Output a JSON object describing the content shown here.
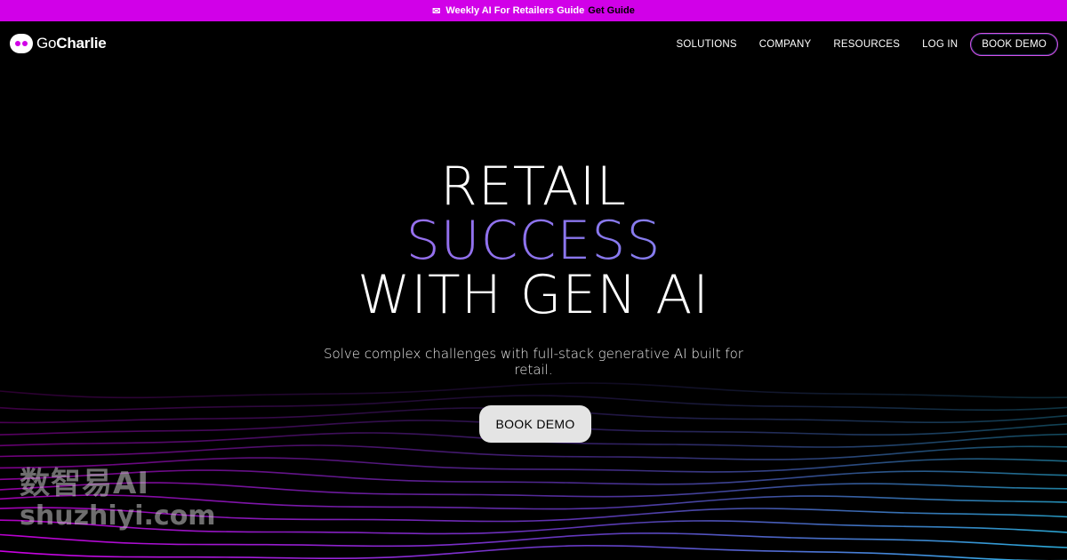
{
  "promo": {
    "icon": "envelope-icon",
    "text": "Weekly AI For Retailers Guide",
    "link": "Get Guide",
    "bg_color": "#d100e8"
  },
  "nav": {
    "logo_prefix": "Go",
    "logo_name": "Charlie",
    "items": [
      {
        "label": "SOLUTIONS"
      },
      {
        "label": "COMPANY"
      },
      {
        "label": "RESOURCES"
      },
      {
        "label": "LOG IN"
      }
    ],
    "demo_button": "BOOK DEMO"
  },
  "hero": {
    "line1": "RETAIL",
    "line2": "SUCCESS",
    "line3": "WITH GEN AI",
    "subtitle": "Solve complex challenges with full-stack generative AI built for retail.",
    "cta": "BOOK DEMO",
    "accent_colors": [
      "#b463ec",
      "#6f9dee"
    ]
  },
  "watermark": {
    "line1": "数智易AI",
    "line2": "shuzhiyi.com"
  }
}
